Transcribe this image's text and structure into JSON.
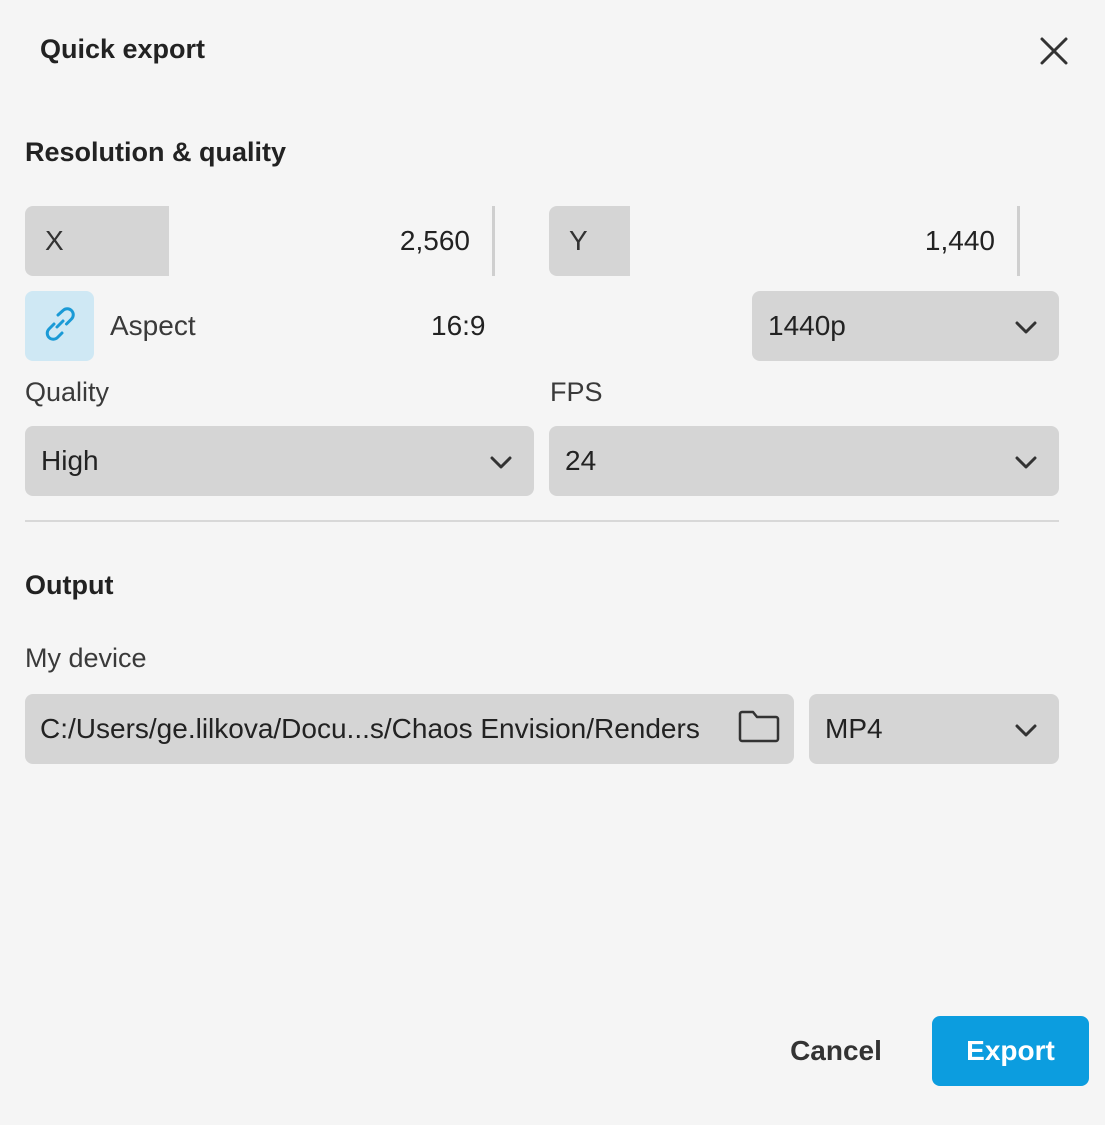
{
  "dialog": {
    "title": "Quick export",
    "close_icon": "close-icon"
  },
  "resolution": {
    "section_title": "Resolution & quality",
    "x": {
      "label": "X",
      "value": "2,560"
    },
    "y": {
      "label": "Y",
      "value": "1,440"
    },
    "aspect": {
      "label": "Aspect",
      "value": "16:9",
      "icon": "link-icon"
    },
    "preset": {
      "selected": "1440p"
    }
  },
  "quality": {
    "label": "Quality",
    "selected": "High"
  },
  "fps": {
    "label": "FPS",
    "selected": "24"
  },
  "output": {
    "section_title": "Output",
    "destination_label": "My device",
    "path": "C:/Users/ge.lilkova/Docu...s/Chaos Envision/Renders",
    "folder_icon": "folder-icon",
    "format": {
      "selected": "MP4"
    }
  },
  "footer": {
    "cancel_label": "Cancel",
    "export_label": "Export"
  },
  "colors": {
    "accent": "#0c9ddf",
    "link_button_bg": "#cfe8f4",
    "field_bg": "#d5d5d5",
    "background": "#f5f5f5"
  }
}
